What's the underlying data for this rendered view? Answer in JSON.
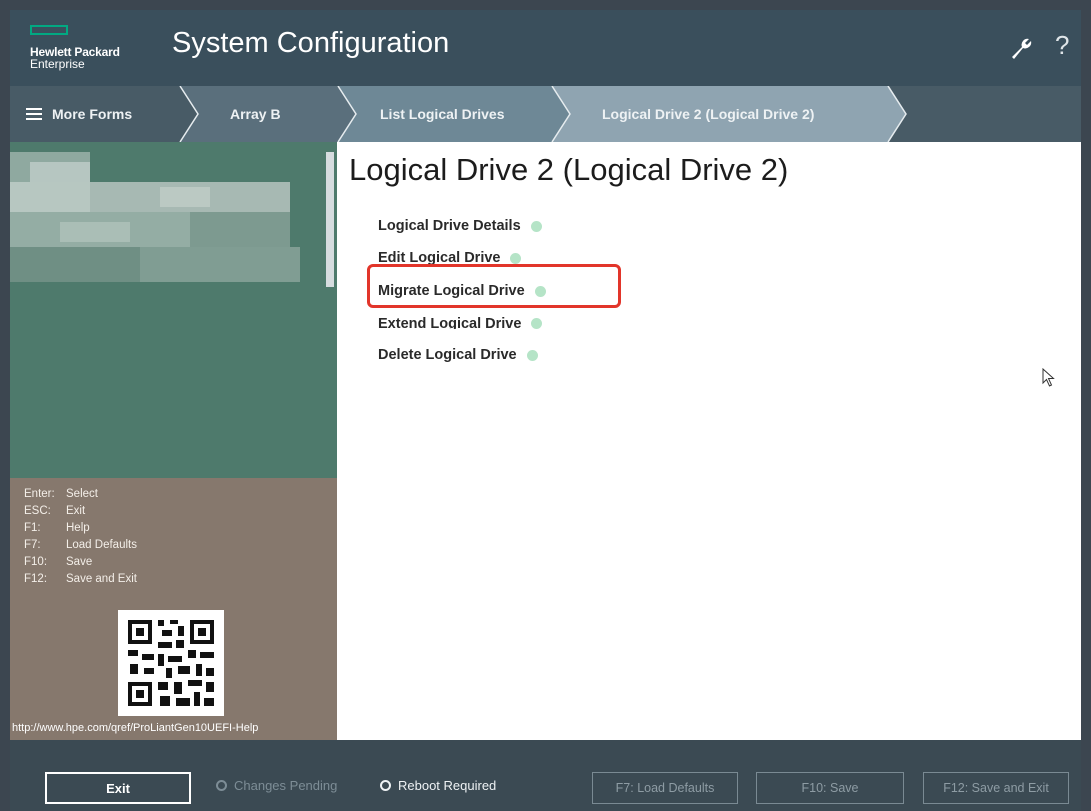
{
  "header": {
    "logo_line1": "Hewlett Packard",
    "logo_line2": "Enterprise",
    "title": "System Configuration",
    "settings_icon": "wrench-icon",
    "help_label": "?"
  },
  "breadcrumb": {
    "more_forms": "More Forms",
    "items": [
      "Array B",
      "List Logical Drives",
      "Logical Drive 2 (Logical Drive 2)"
    ]
  },
  "main": {
    "title": "Logical Drive 2 (Logical Drive 2)",
    "menu": [
      "Logical Drive Details",
      "Edit Logical Drive",
      "Migrate Logical Drive",
      "Extend Logical Drive",
      "Delete Logical Drive"
    ],
    "highlighted_item": "Migrate Logical Drive"
  },
  "help_panel": {
    "keys": [
      {
        "key": "Enter:",
        "action": "Select"
      },
      {
        "key": "ESC:",
        "action": "Exit"
      },
      {
        "key": "F1:",
        "action": "Help"
      },
      {
        "key": "F7:",
        "action": "Load Defaults"
      },
      {
        "key": "F10:",
        "action": "Save"
      },
      {
        "key": "F12:",
        "action": "Save and Exit"
      }
    ],
    "qr_url": "http://www.hpe.com/qref/ProLiantGen10UEFI-Help"
  },
  "footer": {
    "exit": "Exit",
    "changes_pending": "Changes Pending",
    "reboot_required": "Reboot Required",
    "load_defaults": "F7: Load Defaults",
    "save": "F10: Save",
    "save_exit": "F12: Save and Exit"
  },
  "colors": {
    "accent": "#01a982",
    "highlight": "#e2352a",
    "header": "#3a4f5c",
    "left_top": "#4e7a6c",
    "left_bottom": "#86786d"
  }
}
